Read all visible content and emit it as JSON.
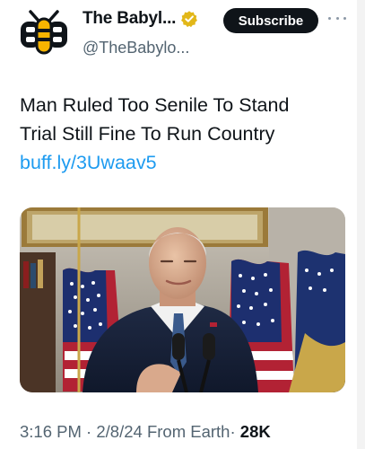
{
  "author": {
    "display_name": "The Babyl...",
    "handle": "@TheBabylo...",
    "verified_icon": "gold-verified-badge-icon",
    "brand_color": "#f6b400"
  },
  "actions": {
    "subscribe_label": "Subscribe",
    "more_icon": "more-horizontal-icon"
  },
  "tweet": {
    "text_lines": [
      "Man Ruled Too Senile To Stand",
      "Trial Still Fine To Run Country"
    ],
    "link": "buff.ly/3Uwaav5"
  },
  "meta": {
    "time": "3:16 PM",
    "sep1": "·",
    "date": "2/8/24",
    "source": "From Earth",
    "sep2": "·",
    "views": "28K"
  },
  "colors": {
    "text": "#0f1419",
    "secondary": "#536471",
    "link": "#1d9bf0",
    "button": "#0f1419"
  }
}
